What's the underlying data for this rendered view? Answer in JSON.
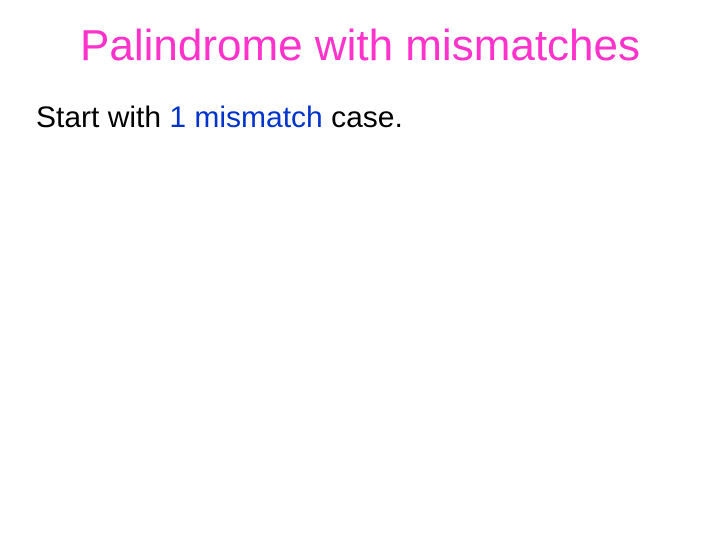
{
  "slide": {
    "title": "Palindrome with mismatches",
    "body": {
      "pre": "Start with ",
      "emph": "1 mismatch",
      "post": " case."
    }
  }
}
